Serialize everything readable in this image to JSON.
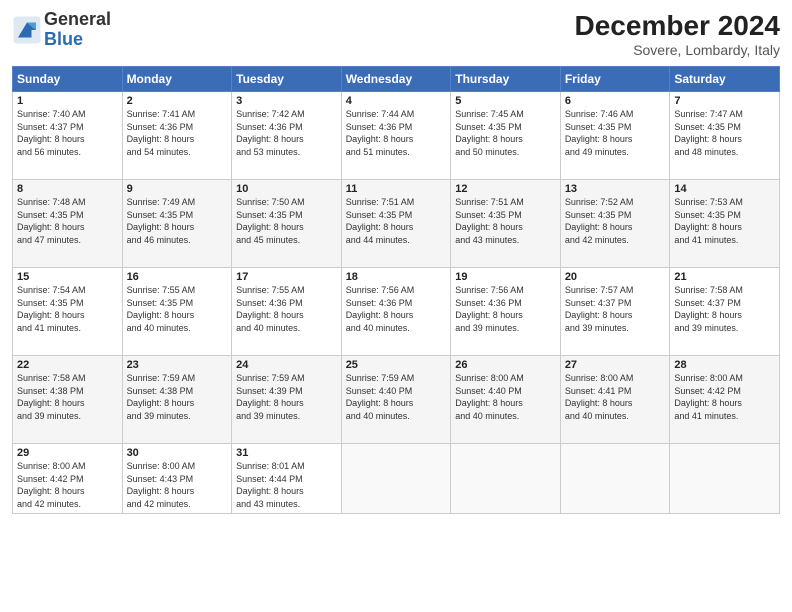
{
  "logo": {
    "general": "General",
    "blue": "Blue"
  },
  "title": "December 2024",
  "location": "Sovere, Lombardy, Italy",
  "weekdays": [
    "Sunday",
    "Monday",
    "Tuesday",
    "Wednesday",
    "Thursday",
    "Friday",
    "Saturday"
  ],
  "weeks": [
    [
      {
        "day": "1",
        "sunrise": "7:40 AM",
        "sunset": "4:37 PM",
        "daylight_h": "8",
        "daylight_m": "56"
      },
      {
        "day": "2",
        "sunrise": "7:41 AM",
        "sunset": "4:36 PM",
        "daylight_h": "8",
        "daylight_m": "54"
      },
      {
        "day": "3",
        "sunrise": "7:42 AM",
        "sunset": "4:36 PM",
        "daylight_h": "8",
        "daylight_m": "53"
      },
      {
        "day": "4",
        "sunrise": "7:44 AM",
        "sunset": "4:36 PM",
        "daylight_h": "8",
        "daylight_m": "51"
      },
      {
        "day": "5",
        "sunrise": "7:45 AM",
        "sunset": "4:35 PM",
        "daylight_h": "8",
        "daylight_m": "50"
      },
      {
        "day": "6",
        "sunrise": "7:46 AM",
        "sunset": "4:35 PM",
        "daylight_h": "8",
        "daylight_m": "49"
      },
      {
        "day": "7",
        "sunrise": "7:47 AM",
        "sunset": "4:35 PM",
        "daylight_h": "8",
        "daylight_m": "48"
      }
    ],
    [
      {
        "day": "8",
        "sunrise": "7:48 AM",
        "sunset": "4:35 PM",
        "daylight_h": "8",
        "daylight_m": "47"
      },
      {
        "day": "9",
        "sunrise": "7:49 AM",
        "sunset": "4:35 PM",
        "daylight_h": "8",
        "daylight_m": "46"
      },
      {
        "day": "10",
        "sunrise": "7:50 AM",
        "sunset": "4:35 PM",
        "daylight_h": "8",
        "daylight_m": "45"
      },
      {
        "day": "11",
        "sunrise": "7:51 AM",
        "sunset": "4:35 PM",
        "daylight_h": "8",
        "daylight_m": "44"
      },
      {
        "day": "12",
        "sunrise": "7:51 AM",
        "sunset": "4:35 PM",
        "daylight_h": "8",
        "daylight_m": "43"
      },
      {
        "day": "13",
        "sunrise": "7:52 AM",
        "sunset": "4:35 PM",
        "daylight_h": "8",
        "daylight_m": "42"
      },
      {
        "day": "14",
        "sunrise": "7:53 AM",
        "sunset": "4:35 PM",
        "daylight_h": "8",
        "daylight_m": "41"
      }
    ],
    [
      {
        "day": "15",
        "sunrise": "7:54 AM",
        "sunset": "4:35 PM",
        "daylight_h": "8",
        "daylight_m": "41"
      },
      {
        "day": "16",
        "sunrise": "7:55 AM",
        "sunset": "4:35 PM",
        "daylight_h": "8",
        "daylight_m": "40"
      },
      {
        "day": "17",
        "sunrise": "7:55 AM",
        "sunset": "4:36 PM",
        "daylight_h": "8",
        "daylight_m": "40"
      },
      {
        "day": "18",
        "sunrise": "7:56 AM",
        "sunset": "4:36 PM",
        "daylight_h": "8",
        "daylight_m": "40"
      },
      {
        "day": "19",
        "sunrise": "7:56 AM",
        "sunset": "4:36 PM",
        "daylight_h": "8",
        "daylight_m": "39"
      },
      {
        "day": "20",
        "sunrise": "7:57 AM",
        "sunset": "4:37 PM",
        "daylight_h": "8",
        "daylight_m": "39"
      },
      {
        "day": "21",
        "sunrise": "7:58 AM",
        "sunset": "4:37 PM",
        "daylight_h": "8",
        "daylight_m": "39"
      }
    ],
    [
      {
        "day": "22",
        "sunrise": "7:58 AM",
        "sunset": "4:38 PM",
        "daylight_h": "8",
        "daylight_m": "39"
      },
      {
        "day": "23",
        "sunrise": "7:59 AM",
        "sunset": "4:38 PM",
        "daylight_h": "8",
        "daylight_m": "39"
      },
      {
        "day": "24",
        "sunrise": "7:59 AM",
        "sunset": "4:39 PM",
        "daylight_h": "8",
        "daylight_m": "39"
      },
      {
        "day": "25",
        "sunrise": "7:59 AM",
        "sunset": "4:40 PM",
        "daylight_h": "8",
        "daylight_m": "40"
      },
      {
        "day": "26",
        "sunrise": "8:00 AM",
        "sunset": "4:40 PM",
        "daylight_h": "8",
        "daylight_m": "40"
      },
      {
        "day": "27",
        "sunrise": "8:00 AM",
        "sunset": "4:41 PM",
        "daylight_h": "8",
        "daylight_m": "40"
      },
      {
        "day": "28",
        "sunrise": "8:00 AM",
        "sunset": "4:42 PM",
        "daylight_h": "8",
        "daylight_m": "41"
      }
    ],
    [
      {
        "day": "29",
        "sunrise": "8:00 AM",
        "sunset": "4:42 PM",
        "daylight_h": "8",
        "daylight_m": "42"
      },
      {
        "day": "30",
        "sunrise": "8:00 AM",
        "sunset": "4:43 PM",
        "daylight_h": "8",
        "daylight_m": "42"
      },
      {
        "day": "31",
        "sunrise": "8:01 AM",
        "sunset": "4:44 PM",
        "daylight_h": "8",
        "daylight_m": "43"
      },
      null,
      null,
      null,
      null
    ]
  ]
}
